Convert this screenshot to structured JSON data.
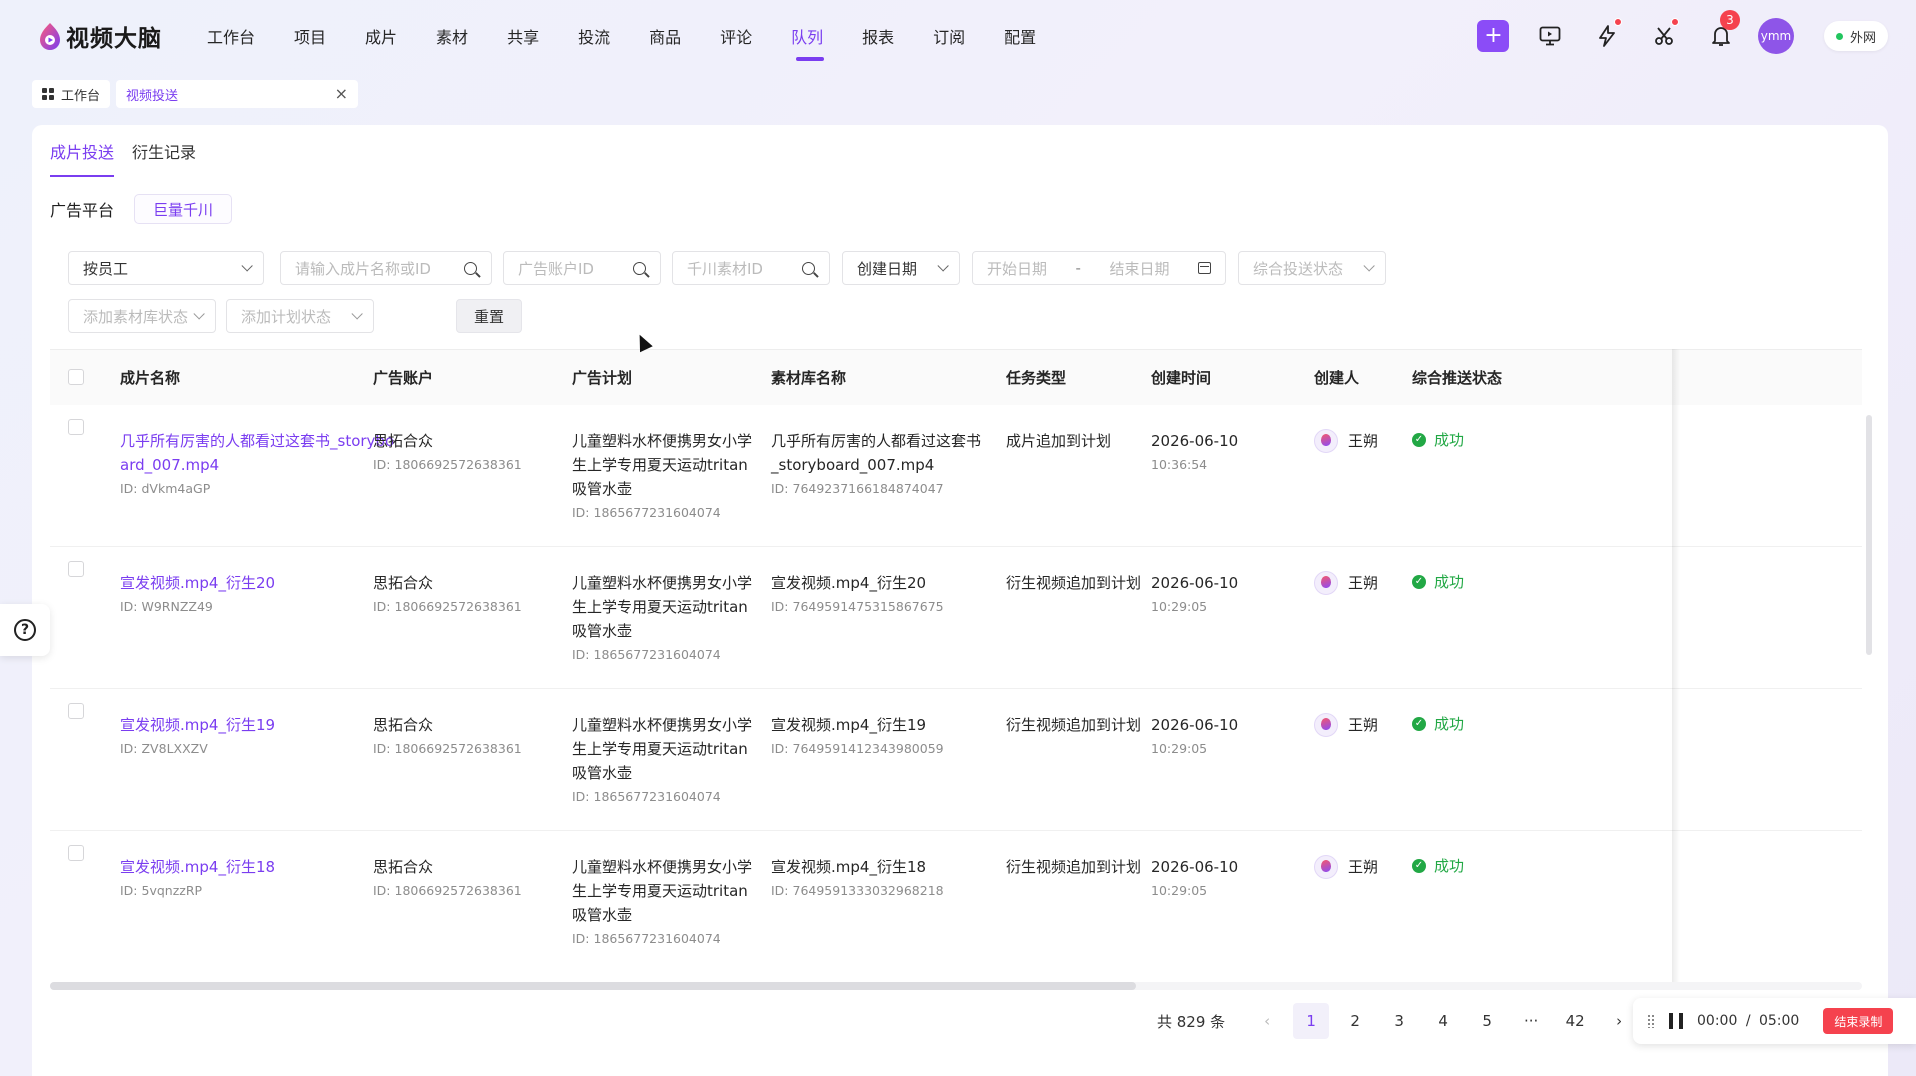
{
  "app": {
    "logo_text": "视频大脑"
  },
  "nav": [
    {
      "label": "工作台"
    },
    {
      "label": "项目"
    },
    {
      "label": "成片"
    },
    {
      "label": "素材"
    },
    {
      "label": "共享"
    },
    {
      "label": "投流"
    },
    {
      "label": "商品"
    },
    {
      "label": "评论"
    },
    {
      "label": "队列",
      "active": true
    },
    {
      "label": "报表"
    },
    {
      "label": "订阅"
    },
    {
      "label": "配置"
    }
  ],
  "top_actions": {
    "notification_count": "3",
    "avatar_text": "ymm",
    "network_label": "外网"
  },
  "tabstrip": {
    "home": "工作台",
    "current": "视频投送"
  },
  "subtabs": [
    {
      "label": "成片投送",
      "active": true
    },
    {
      "label": "衍生记录"
    }
  ],
  "platform": {
    "label": "广告平台",
    "selected": "巨量千川"
  },
  "filters": {
    "employee": "按员工",
    "video_search_placeholder": "请输入成片名称或ID",
    "ad_account_placeholder": "广告账户ID",
    "qc_material_placeholder": "千川素材ID",
    "date_type": "创建日期",
    "start_date_placeholder": "开始日期",
    "date_sep": "-",
    "end_date_placeholder": "结束日期",
    "overall_status_placeholder": "综合投送状态",
    "add_library_status_placeholder": "添加素材库状态",
    "add_plan_status_placeholder": "添加计划状态",
    "reset": "重置"
  },
  "table": {
    "columns": [
      "成片名称",
      "广告账户",
      "广告计划",
      "素材库名称",
      "任务类型",
      "创建时间",
      "创建人",
      "综合推送状态"
    ],
    "rows": [
      {
        "name": "几乎所有厉害的人都看过这套书_storyboard_007.mp4",
        "name_id": "ID: dVkm4aGP",
        "account": "思拓合众",
        "account_id": "ID: 1806692572638361",
        "plan": "儿童塑料水杯便携男女小学生上学专用夏天运动tritan吸管水壶",
        "plan_id": "ID: 1865677231604074",
        "library": "几乎所有厉害的人都看过这套书_storyboard_007.mp4",
        "library_id": "ID: 7649237166184874047",
        "task": "成片追加到计划",
        "date": "2026-06-10",
        "time": "10:36:54",
        "creator": "王朔",
        "status": "成功"
      },
      {
        "name": "宣发视频.mp4_衍生20",
        "name_id": "ID: W9RNZZ49",
        "account": "思拓合众",
        "account_id": "ID: 1806692572638361",
        "plan": "儿童塑料水杯便携男女小学生上学专用夏天运动tritan吸管水壶",
        "plan_id": "ID: 1865677231604074",
        "library": "宣发视频.mp4_衍生20",
        "library_id": "ID: 7649591475315867675",
        "task": "衍生视频追加到计划",
        "date": "2026-06-10",
        "time": "10:29:05",
        "creator": "王朔",
        "status": "成功"
      },
      {
        "name": "宣发视频.mp4_衍生19",
        "name_id": "ID: ZV8LXXZV",
        "account": "思拓合众",
        "account_id": "ID: 1806692572638361",
        "plan": "儿童塑料水杯便携男女小学生上学专用夏天运动tritan吸管水壶",
        "plan_id": "ID: 1865677231604074",
        "library": "宣发视频.mp4_衍生19",
        "library_id": "ID: 7649591412343980059",
        "task": "衍生视频追加到计划",
        "date": "2026-06-10",
        "time": "10:29:05",
        "creator": "王朔",
        "status": "成功"
      },
      {
        "name": "宣发视频.mp4_衍生18",
        "name_id": "ID: 5vqnzzRP",
        "account": "思拓合众",
        "account_id": "ID: 1806692572638361",
        "plan": "儿童塑料水杯便携男女小学生上学专用夏天运动tritan吸管水壶",
        "plan_id": "ID: 1865677231604074",
        "library": "宣发视频.mp4_衍生18",
        "library_id": "ID: 7649591333032968218",
        "task": "衍生视频追加到计划",
        "date": "2026-06-10",
        "time": "10:29:05",
        "creator": "王朔",
        "status": "成功"
      }
    ]
  },
  "pagination": {
    "total": "共 829 条",
    "pages": [
      "1",
      "2",
      "3",
      "4",
      "5"
    ],
    "ellipsis": "···",
    "last": "42",
    "current": "1"
  },
  "recorder": {
    "elapsed": "00:00",
    "sep": "/",
    "limit": "05:00",
    "end_label": "结束录制"
  },
  "colors": {
    "accent": "#7a3df0",
    "success": "#22a845",
    "danger": "#f5424e"
  }
}
